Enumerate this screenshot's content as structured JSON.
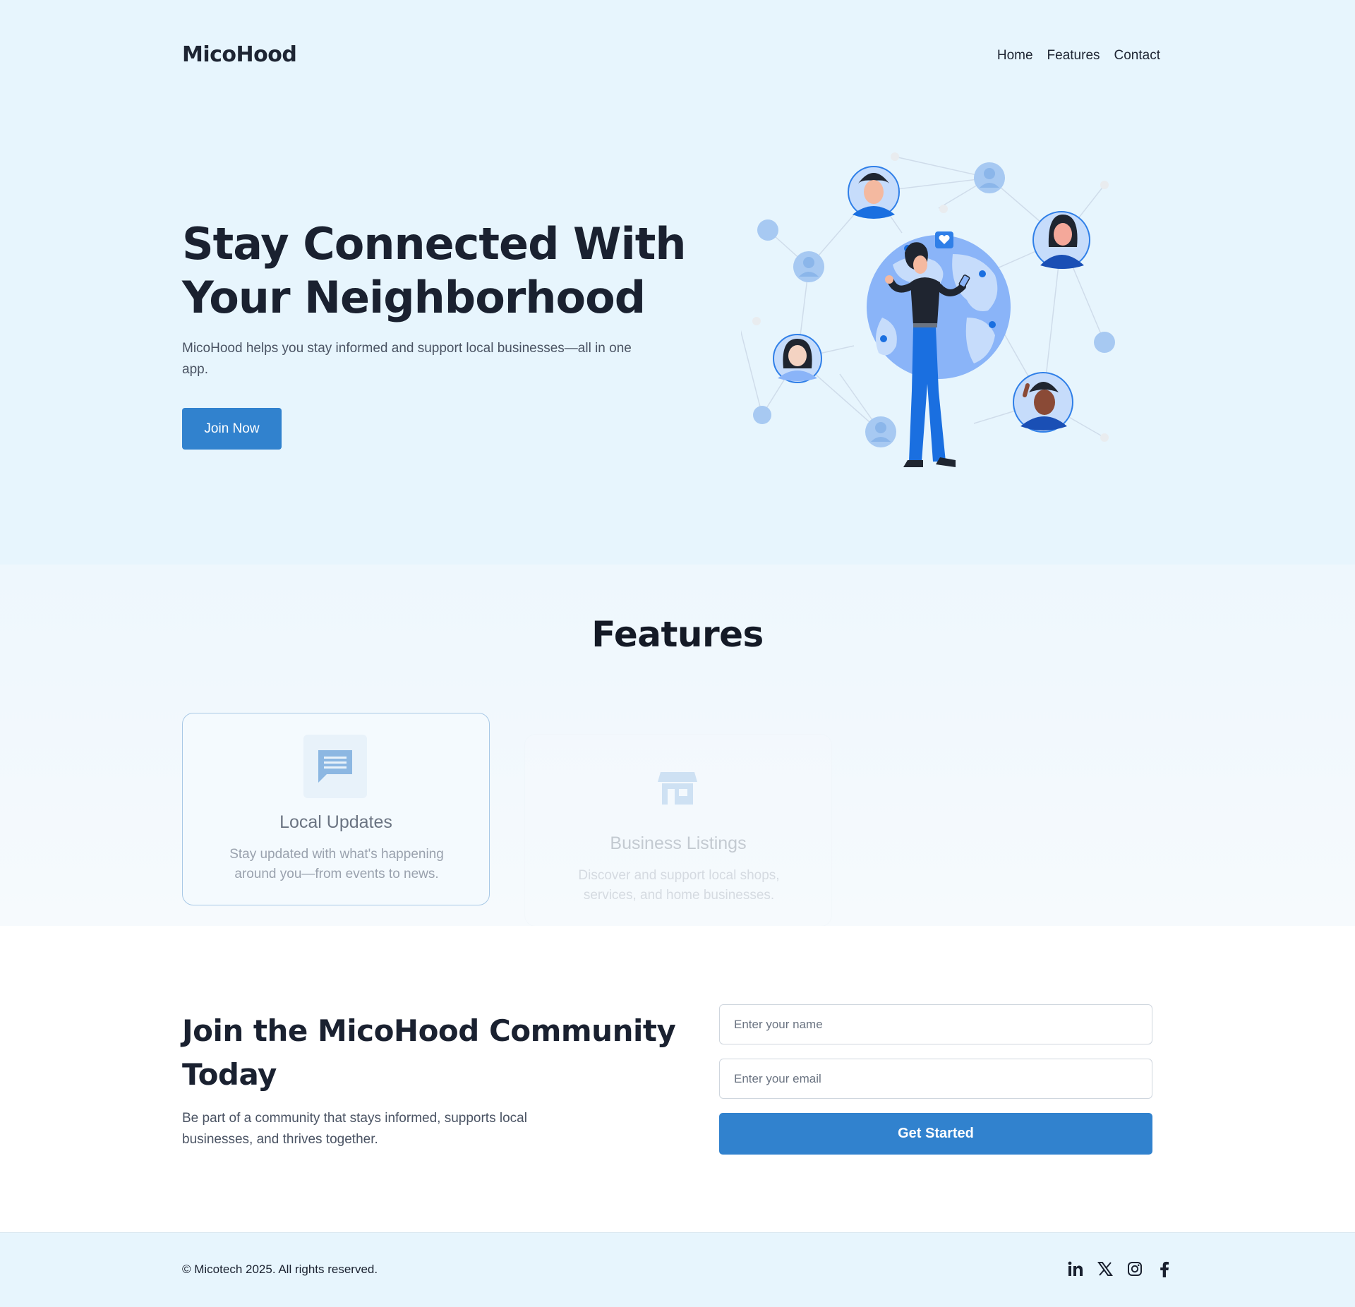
{
  "brand": {
    "logo": "MicoHood"
  },
  "nav": {
    "items": [
      "Home",
      "Features",
      "Contact"
    ]
  },
  "hero": {
    "title": "Stay Connected With Your Neighborhood",
    "subtitle": "MicoHood helps you stay informed and support local businesses—all in one app.",
    "cta": "Join Now",
    "illustration_icon": "community-network-illustration"
  },
  "features": {
    "title": "Features",
    "cards": [
      {
        "icon": "chat-message-icon",
        "title": "Local Updates",
        "desc": "Stay updated with what's happening around you—from events to news."
      },
      {
        "icon": "storefront-icon",
        "title": "Business Listings",
        "desc": "Discover and support local shops, services, and home businesses."
      }
    ]
  },
  "join": {
    "title": "Join the MicoHood Community Today",
    "subtitle": "Be part of a community that stays informed, supports local businesses, and thrives together.",
    "name_placeholder": "Enter your name",
    "email_placeholder": "Enter your email",
    "cta": "Get Started"
  },
  "footer": {
    "copyright": "© Micotech 2025. All rights reserved.",
    "socials": [
      "linkedin-icon",
      "x-icon",
      "instagram-icon",
      "facebook-icon"
    ]
  },
  "colors": {
    "accent": "#3182ce",
    "hero_bg": "#e7f5fd",
    "text_dark": "#1a2130"
  }
}
